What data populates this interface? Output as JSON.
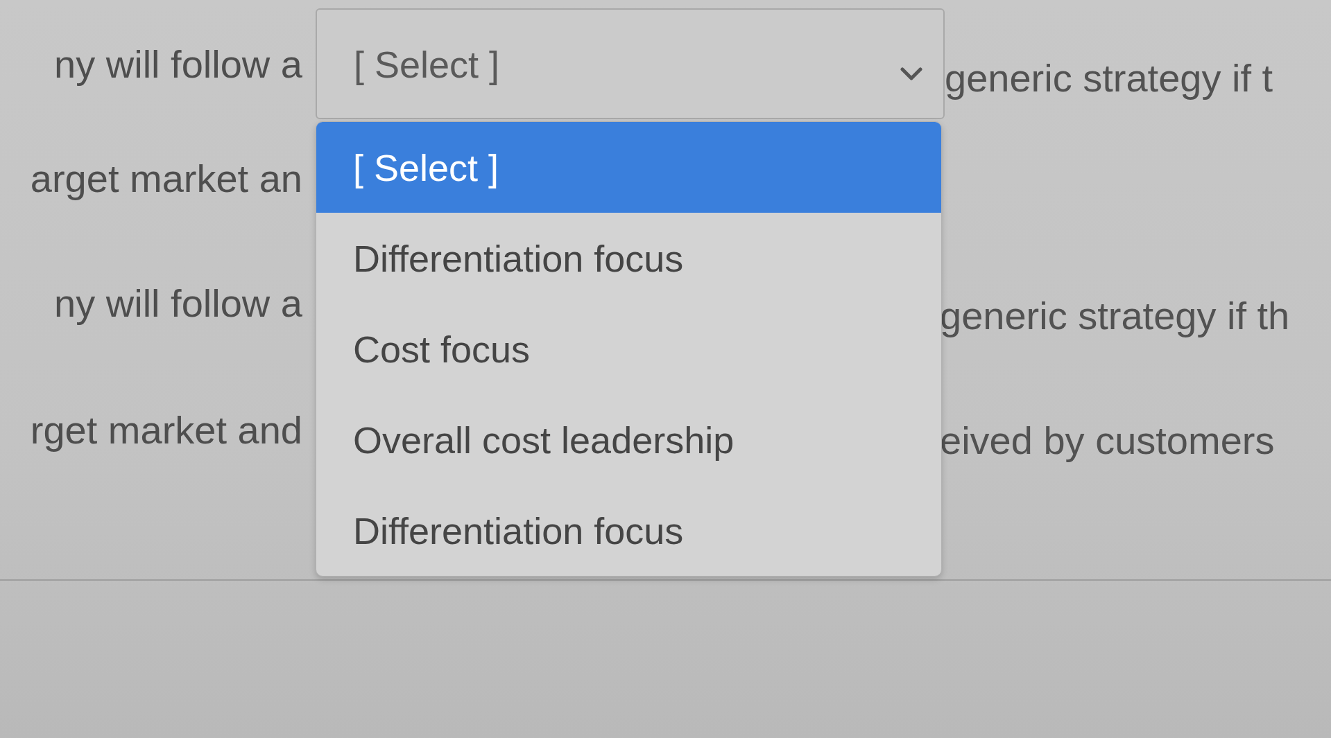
{
  "rows": [
    {
      "before": "ny will follow a",
      "select": {
        "value": "[ Select ]",
        "expanded": true,
        "options": [
          {
            "label": "[ Select ]",
            "selected": true
          },
          {
            "label": "Differentiation focus",
            "selected": false
          },
          {
            "label": "Cost focus",
            "selected": false
          },
          {
            "label": "Overall cost leadership",
            "selected": false
          },
          {
            "label": "Differentiation focus",
            "selected": false
          }
        ]
      },
      "after": "generic strategy if t"
    },
    {
      "before": "arget market an"
    },
    {
      "before": "ny will follow a",
      "after": "generic strategy if th"
    },
    {
      "before": "rget market and",
      "after": "eived by customers"
    }
  ]
}
